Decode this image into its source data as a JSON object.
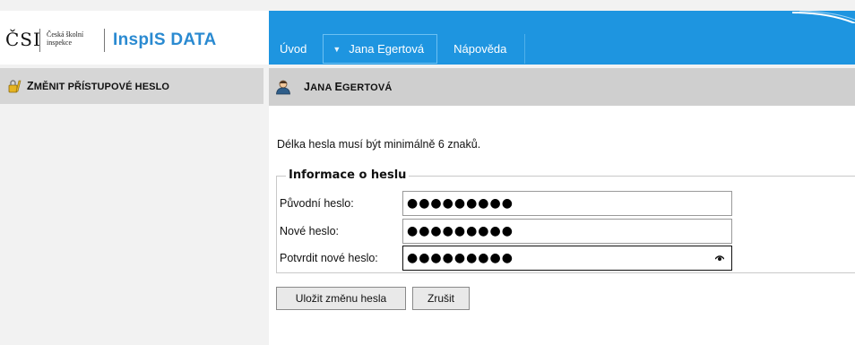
{
  "header": {
    "logo_csi": "ČSI",
    "logo_sub_line1": "Česká školní",
    "logo_sub_line2": "inspekce",
    "logo_app": "InspIS DATA"
  },
  "nav": {
    "items": [
      {
        "label": "Úvod"
      },
      {
        "label": "Jana Egertová"
      },
      {
        "label": "Nápověda"
      }
    ]
  },
  "sidebar": {
    "items": [
      {
        "label_first": "Z",
        "label_rest": "MĚNIT PŘÍSTUPOVÉ HESLO",
        "icon": "lock-key-icon"
      }
    ]
  },
  "main": {
    "title_first": "J",
    "title_rest": "ANA ",
    "title_first2": "E",
    "title_rest2": "GERTOVÁ",
    "info": "Délka hesla musí být minimálně 6 znaků.",
    "fieldset_legend": "Informace o heslu",
    "fields": [
      {
        "label": "Původní heslo:",
        "value": "●●●●●●●●●"
      },
      {
        "label": "Nové heslo:",
        "value": "●●●●●●●●●"
      },
      {
        "label": "Potvrdit nové heslo:",
        "value": "●●●●●●●●●"
      }
    ],
    "buttons": {
      "save": "Uložit změnu hesla",
      "cancel": "Zrušit"
    }
  },
  "colors": {
    "topbar": "#1e95e0",
    "app_name": "#2a8ad1",
    "sidebar_item": "#d6d6d6",
    "panel_header": "#cfcfcf"
  }
}
